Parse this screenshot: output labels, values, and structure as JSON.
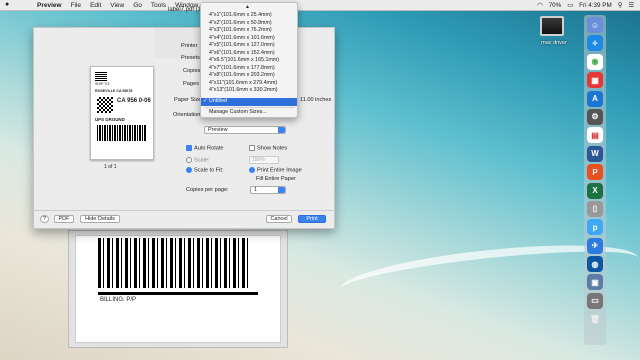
{
  "menubar": {
    "app": "Preview",
    "items": [
      "File",
      "Edit",
      "View",
      "Go",
      "Tools",
      "Window"
    ],
    "battery": "70%",
    "time": "Fri 4:39 PM"
  },
  "desktop": {
    "icon_label": "mac driver"
  },
  "window": {
    "title": "label7.pdf (1 p"
  },
  "dialog": {
    "printer_label": "Printer",
    "presets_label": "Presets",
    "copies_label": "Copies",
    "pages_label": "Pages",
    "paper_size_label": "Paper Size",
    "paper_size_value": "Untitled",
    "paper_size_dims": "11.00 inches",
    "orientation_label": "Orientation",
    "section_value": "Preview",
    "auto_rotate": "Auto Rotate",
    "show_notes": "Show Notes",
    "scale": "Scale:",
    "scale_value": "100%",
    "scale_to_fit": "Scale to Fit:",
    "print_entire_image": "Print Entire Image",
    "fill_entire_paper": "Fill Entire Paper",
    "copies_per_page_label": "Copies per page:",
    "copies_per_page_value": "1",
    "page_indicator": "1 of 1",
    "help": "?",
    "pdf": "PDF",
    "hide_details": "Hide Details",
    "cancel": "Cancel",
    "print": "Print"
  },
  "label": {
    "line1": "SHIP TO:",
    "city": "ROSEVILLE CA 95678",
    "code": "CA 956 0-06",
    "carrier": "UPS GROUND",
    "billing": "BILLING: P/P"
  },
  "paper_menu": {
    "items": [
      "4\"x1\"(101.6mm x 25.4mm)",
      "4\"x2\"(101.6mm x 50.8mm)",
      "4\"x3\"(101.6mm x 76.2mm)",
      "4\"x4\"(101.6mm x 101.6mm)",
      "4\"x5\"(101.6mm x 127.0mm)",
      "4\"x6\"(101.6mm x 152.4mm)",
      "4\"x6.5\"(101.6mm x 165.1mm)",
      "4\"x7\"(101.6mm x 177.8mm)",
      "4\"x8\"(101.6mm x 203.2mm)",
      "4\"x11\"(101.6mm x 279.4mm)",
      "4\"x13\"(101.6mm x 330.2mm)"
    ],
    "selected": "Untitled",
    "manage": "Manage Custom Sizes..."
  }
}
